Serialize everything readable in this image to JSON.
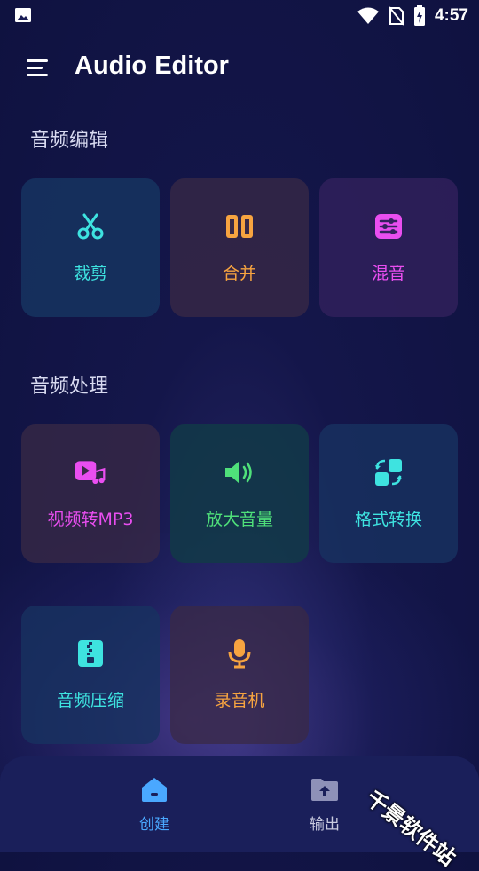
{
  "status_bar": {
    "time": "4:57"
  },
  "app_bar": {
    "title": "Audio Editor"
  },
  "sections": {
    "edit": {
      "title": "音频编辑",
      "tiles": [
        {
          "label": "裁剪",
          "icon": "scissors-icon",
          "color": "#3ee3e0"
        },
        {
          "label": "合并",
          "icon": "merge-icon",
          "color": "#f7a440"
        },
        {
          "label": "混音",
          "icon": "mixer-icon",
          "color": "#e94ef0"
        }
      ]
    },
    "process": {
      "title": "音频处理",
      "tiles": [
        {
          "label": "视频转MP3",
          "icon": "video-to-music-icon",
          "color": "#e94ef0"
        },
        {
          "label": "放大音量",
          "icon": "volume-up-icon",
          "color": "#4fe07a"
        },
        {
          "label": "格式转换",
          "icon": "format-convert-icon",
          "color": "#3ee3e0"
        },
        {
          "label": "音频压缩",
          "icon": "zip-icon",
          "color": "#3ee3e0"
        },
        {
          "label": "录音机",
          "icon": "microphone-icon",
          "color": "#f7a440"
        }
      ]
    }
  },
  "bottom_nav": {
    "items": [
      {
        "label": "创建",
        "icon": "home-icon",
        "active": true,
        "color": "#4aa8ff"
      },
      {
        "label": "输出",
        "icon": "folder-upload-icon",
        "active": false,
        "color": "#c9cbe0"
      }
    ]
  },
  "watermark": "千景软件站"
}
